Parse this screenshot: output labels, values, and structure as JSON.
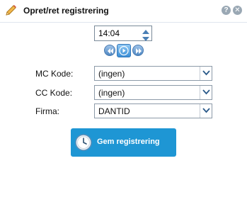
{
  "dialog": {
    "title": "Opret/ret registrering",
    "help_icon": "help-icon",
    "close_icon": "close-icon",
    "edit_icon": "pencil-icon"
  },
  "time": {
    "value": "14:04"
  },
  "fields": {
    "mc_code": {
      "label": "MC Kode:",
      "value": "(ingen)"
    },
    "cc_code": {
      "label": "CC Kode:",
      "value": "(ingen)"
    },
    "company": {
      "label": "Firma:",
      "value": "DANTID"
    }
  },
  "save_button": {
    "label": "Gem registrering",
    "icon": "clock-icon"
  },
  "colors": {
    "accent": "#1e96d4",
    "nav": "#4f87c2"
  }
}
